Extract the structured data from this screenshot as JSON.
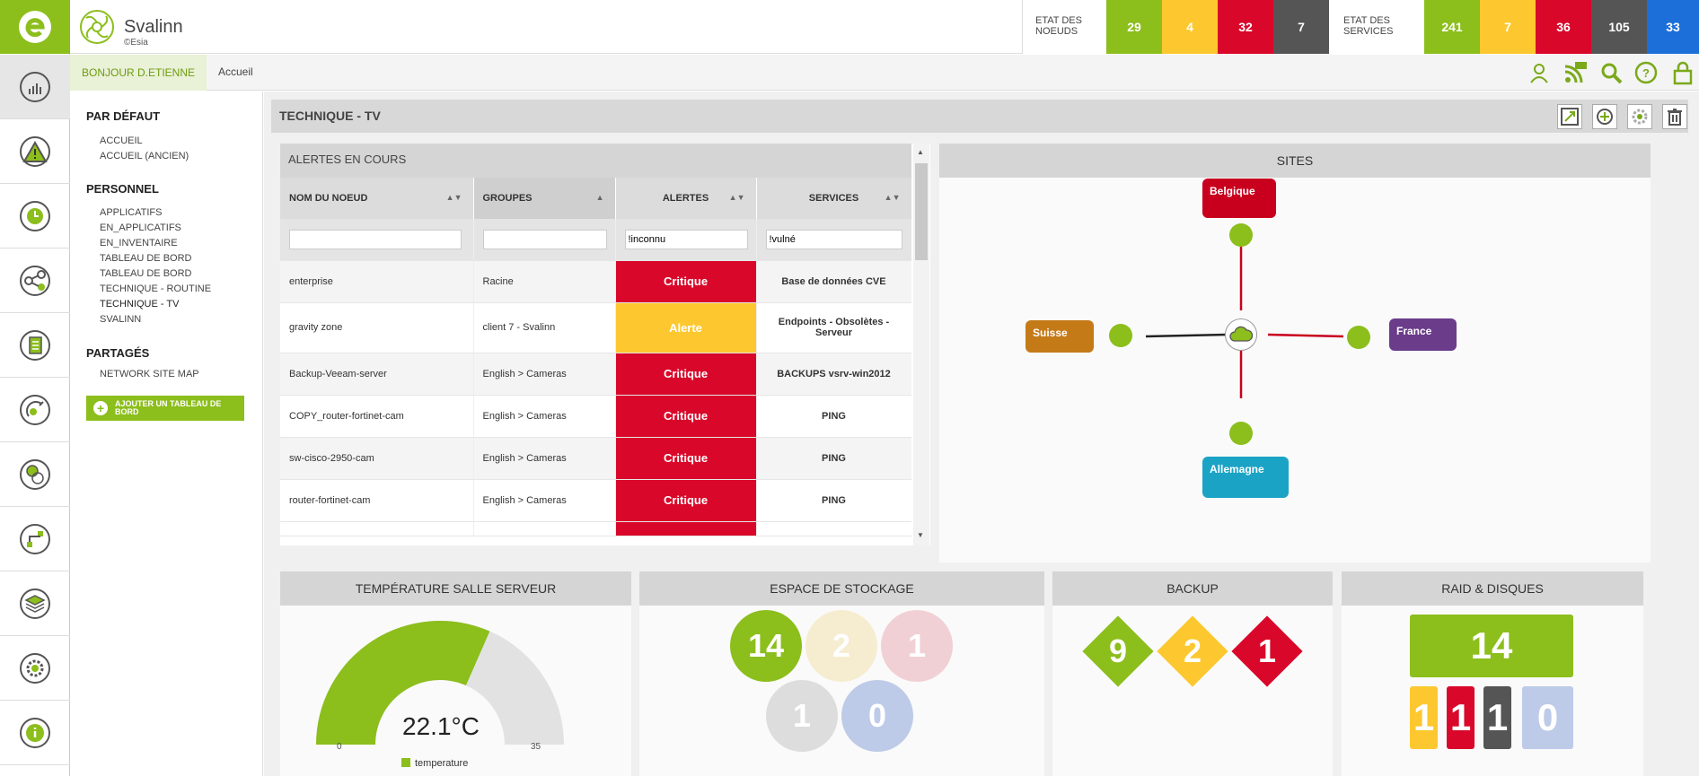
{
  "app": {
    "name": "Svalinn",
    "sub": "©Esia"
  },
  "header": {
    "nodes_label": "ETAT DES NOEUDS",
    "services_label": "ETAT DES SERVICES",
    "nodes": [
      {
        "value": "29",
        "color": "#8cbe1c"
      },
      {
        "value": "4",
        "color": "#fdc82f"
      },
      {
        "value": "32",
        "color": "#d9082a"
      },
      {
        "value": "7",
        "color": "#555555"
      }
    ],
    "services": [
      {
        "value": "241",
        "color": "#8cbe1c"
      },
      {
        "value": "7",
        "color": "#fdc82f"
      },
      {
        "value": "36",
        "color": "#d9082a"
      },
      {
        "value": "105",
        "color": "#555555"
      },
      {
        "value": "33",
        "color": "#1c6fd9"
      }
    ]
  },
  "topbar": {
    "greeting": "BONJOUR D.ETIENNE",
    "breadcrumb": "Accueil"
  },
  "sidebar_icons": [
    "dashboard-icon",
    "warning-icon",
    "history-icon",
    "share-icon",
    "document-icon",
    "satellite-icon",
    "network-icon",
    "topology-icon",
    "layers-icon",
    "settings-icon",
    "info-icon"
  ],
  "dashboards": {
    "default_title": "PAR DÉFAUT",
    "default": [
      "ACCUEIL",
      "ACCUEIL (ANCIEN)"
    ],
    "personal_title": "PERSONNEL",
    "personal": [
      "APPLICATIFS",
      "EN_APPLICATIFS",
      "EN_INVENTAIRE",
      "TABLEAU DE BORD",
      "TABLEAU DE BORD",
      "TECHNIQUE - ROUTINE",
      "TECHNIQUE - TV",
      "SVALINN"
    ],
    "shared_title": "PARTAGÉS",
    "shared": [
      "NETWORK SITE MAP"
    ],
    "add_label": "AJOUTER UN TABLEAU DE BORD"
  },
  "page": {
    "title": "TECHNIQUE - TV"
  },
  "alerts": {
    "title": "ALERTES EN COURS",
    "columns": [
      "NOM DU NOEUD",
      "GROUPES",
      "ALERTES",
      "SERVICES"
    ],
    "filters": [
      "",
      "",
      "!inconnu",
      "!vulné"
    ],
    "rows": [
      {
        "node": "enterprise",
        "group": "Racine",
        "alert": "Critique",
        "color": "#d9082a",
        "service": "Base de données CVE"
      },
      {
        "node": "gravity zone",
        "group": "client 7 - Svalinn",
        "alert": "Alerte",
        "color": "#fdc82f",
        "service": "Endpoints - Obsolètes - Serveur"
      },
      {
        "node": "Backup-Veeam-server",
        "group": "English > Cameras",
        "alert": "Critique",
        "color": "#d9082a",
        "service": "BACKUPS vsrv-win2012"
      },
      {
        "node": "COPY_router-fortinet-cam",
        "group": "English > Cameras",
        "alert": "Critique",
        "color": "#d9082a",
        "service": "PING"
      },
      {
        "node": "sw-cisco-2950-cam",
        "group": "English > Cameras",
        "alert": "Critique",
        "color": "#d9082a",
        "service": "PING"
      },
      {
        "node": "router-fortinet-cam",
        "group": "English > Cameras",
        "alert": "Critique",
        "color": "#d9082a",
        "service": "PING"
      }
    ]
  },
  "sites": {
    "title": "SITES",
    "nodes": [
      {
        "name": "Belgique",
        "color": "#c8001e"
      },
      {
        "name": "Suisse",
        "color": "#c57a18"
      },
      {
        "name": "France",
        "color": "#6a3c8a"
      },
      {
        "name": "Allemagne",
        "color": "#1ba3c6"
      }
    ]
  },
  "temperature": {
    "title": "TEMPÉRATURE SALLE SERVEUR",
    "value": 22.1,
    "display": "22.1°C",
    "min": "0",
    "max": "35",
    "legend": "temperature",
    "color": "#8cbe1c"
  },
  "storage": {
    "title": "ESPACE DE STOCKAGE",
    "values": [
      {
        "v": "14",
        "color": "#8cbe1c"
      },
      {
        "v": "2",
        "color": "#f6ecd0"
      },
      {
        "v": "1",
        "color": "#f1d0d5"
      },
      {
        "v": "1",
        "color": "#dddddd"
      },
      {
        "v": "0",
        "color": "#bdcbe8"
      }
    ]
  },
  "backup": {
    "title": "BACKUP",
    "values": [
      {
        "v": "9",
        "color": "#8cbe1c"
      },
      {
        "v": "2",
        "color": "#fdc82f"
      },
      {
        "v": "1",
        "color": "#d9082a"
      }
    ]
  },
  "raid": {
    "title": "RAID & DISQUES",
    "main": "14",
    "main_color": "#8cbe1c",
    "values": [
      {
        "v": "1",
        "color": "#fdc82f"
      },
      {
        "v": "1",
        "color": "#d9082a"
      },
      {
        "v": "1",
        "color": "#555555"
      },
      {
        "v": "0",
        "color": "#bdcbe8"
      }
    ]
  }
}
